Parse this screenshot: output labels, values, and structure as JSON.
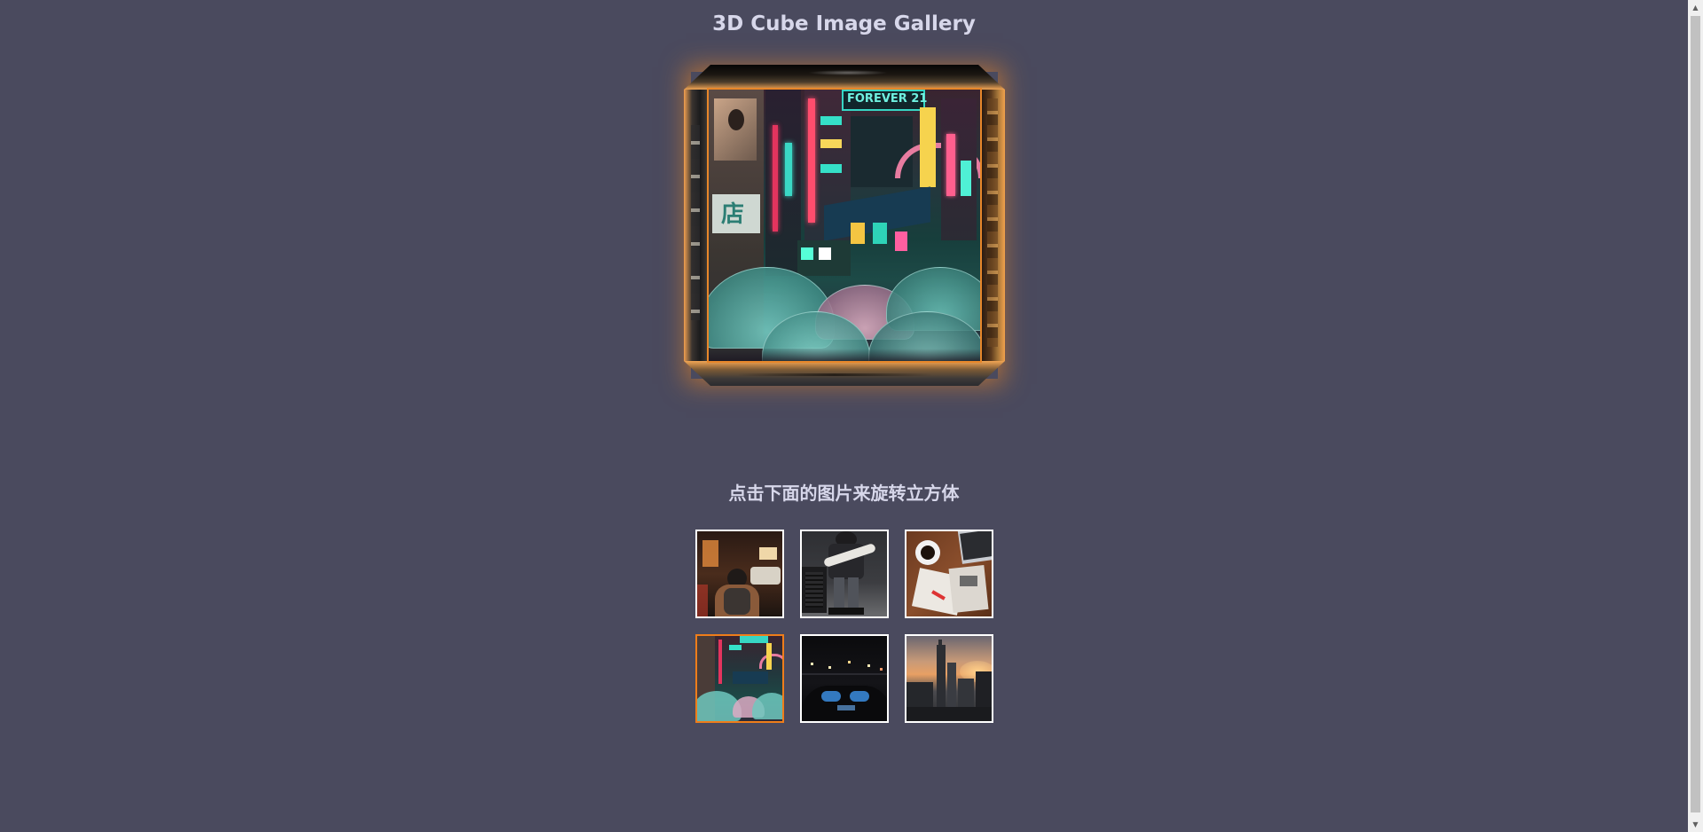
{
  "page": {
    "title": "3D Cube Image Gallery",
    "instruction": "点击下面的图片来旋转立方体"
  },
  "cube": {
    "front_sign_text": "FOREVER 21",
    "front_store_text": "店",
    "accent_color": "#ef7d1a"
  },
  "thumbnails": [
    {
      "name": "street-night-walker",
      "active": false
    },
    {
      "name": "guitar-player",
      "active": false
    },
    {
      "name": "desk-coffee-laptop",
      "active": false
    },
    {
      "name": "neon-street-umbrellas",
      "active": true
    },
    {
      "name": "car-dashboard-night",
      "active": false
    },
    {
      "name": "city-skyline-sunset",
      "active": false
    }
  ],
  "colors": {
    "background": "#4a4a5e",
    "heading_text": "#d7d7ea",
    "thumb_border": "#ffffff",
    "active_border": "#ef7d1a"
  }
}
